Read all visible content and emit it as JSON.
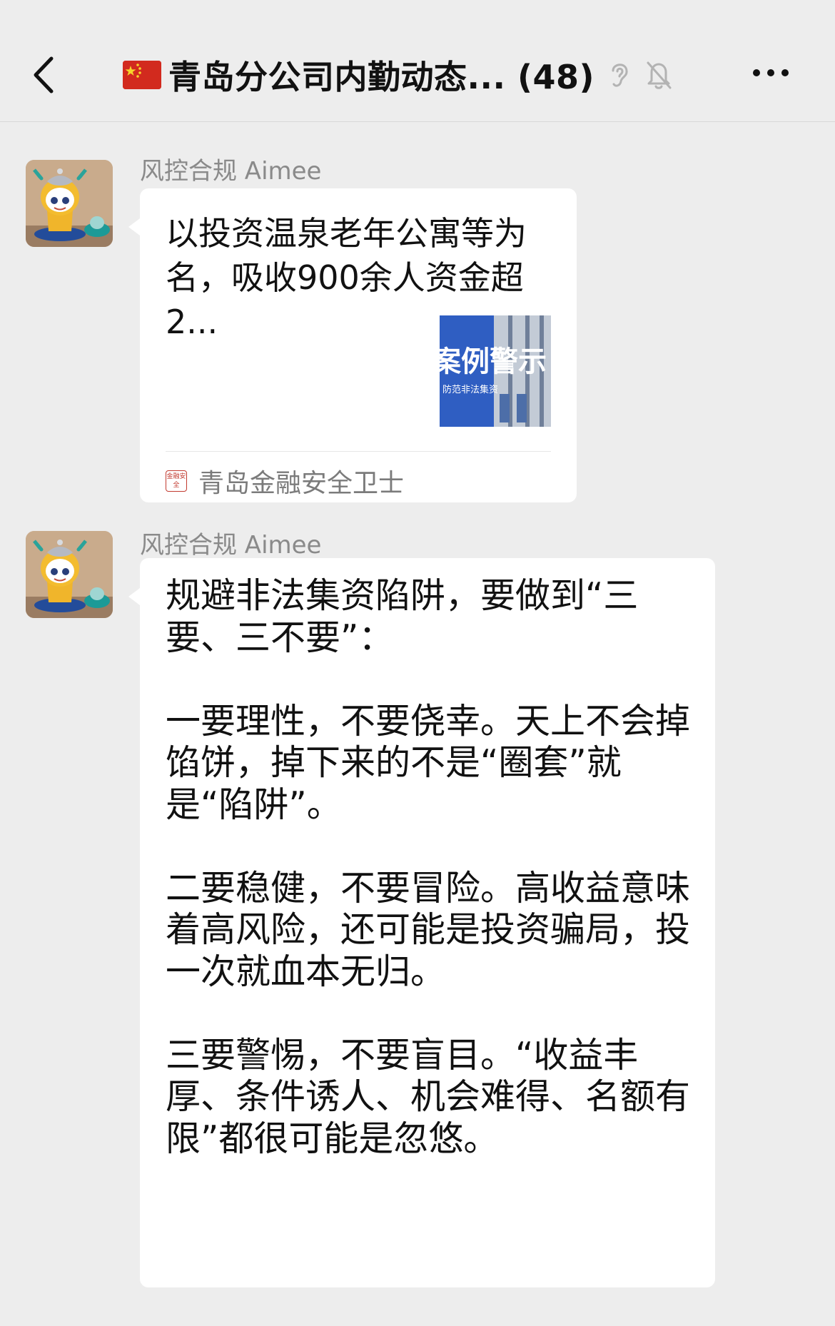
{
  "header": {
    "title": "青岛分公司内勤动态... (48)",
    "icons": [
      "back-icon",
      "china-flag-icon",
      "ear-icon",
      "mute-bell-icon",
      "more-icon"
    ]
  },
  "messages": [
    {
      "type": "card",
      "sender": "风控合规 Aimee",
      "title": "以投资温泉老年公寓等为名，吸收900余人资金超2...",
      "thumbnail": {
        "line1": "案例警示",
        "line2": "防范非法集资",
        "bg": "#2f5ec2"
      },
      "source": {
        "logo": "金融安全",
        "name": "青岛金融安全卫士"
      }
    },
    {
      "type": "text",
      "sender": "风控合规 Aimee",
      "paragraphs": [
        "规避非法集资陷阱，要做到“三要、三不要”：",
        "一要理性，不要侥幸。天上不会掉馅饼，掉下来的不是“圈套”就是“陷阱”。",
        "二要稳健，不要冒险。高收益意味着高风险，还可能是投资骗局，投一次就血本无归。",
        "三要警惕，不要盲目。“收益丰厚、条件诱人、机会难得、名额有限”都很可能是忽悠。"
      ]
    }
  ],
  "colors": {
    "background": "#ededed",
    "bubble": "#ffffff",
    "sender": "#8a8a8a",
    "flag_red": "#d22a1e",
    "thumb_blue": "#2f5ec2"
  }
}
